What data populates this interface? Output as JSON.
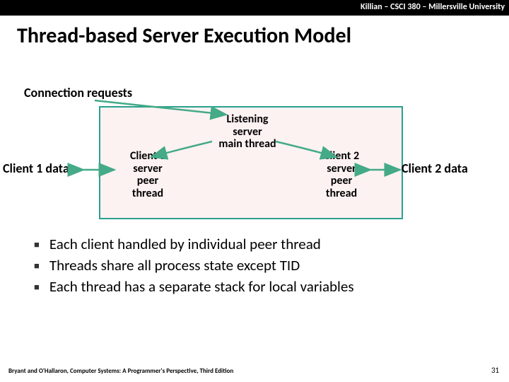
{
  "header": {
    "course": "Killian – CSCI 380 – Millersville University"
  },
  "title": "Thread-based Server Execution Model",
  "diagram": {
    "connection_requests": "Connection requests",
    "client1_data": "Client 1 data",
    "client2_data": "Client 2 data",
    "listening_l1": "Listening",
    "listening_l2": "server",
    "listening_l3": "main thread",
    "peer1_l1": "Client 1",
    "peer1_l2": "server",
    "peer1_l3": "peer",
    "peer1_l4": "thread",
    "peer2_l1": "Client 2",
    "peer2_l2": "server",
    "peer2_l3": "peer",
    "peer2_l4": "thread"
  },
  "bullets": [
    "Each client handled by individual peer thread",
    "Threads share all process state except TID",
    "Each thread has a separate stack for local variables"
  ],
  "footer": {
    "left": "Bryant and O'Hallaron, Computer Systems: A Programmer's Perspective, Third Edition",
    "page": "31"
  }
}
